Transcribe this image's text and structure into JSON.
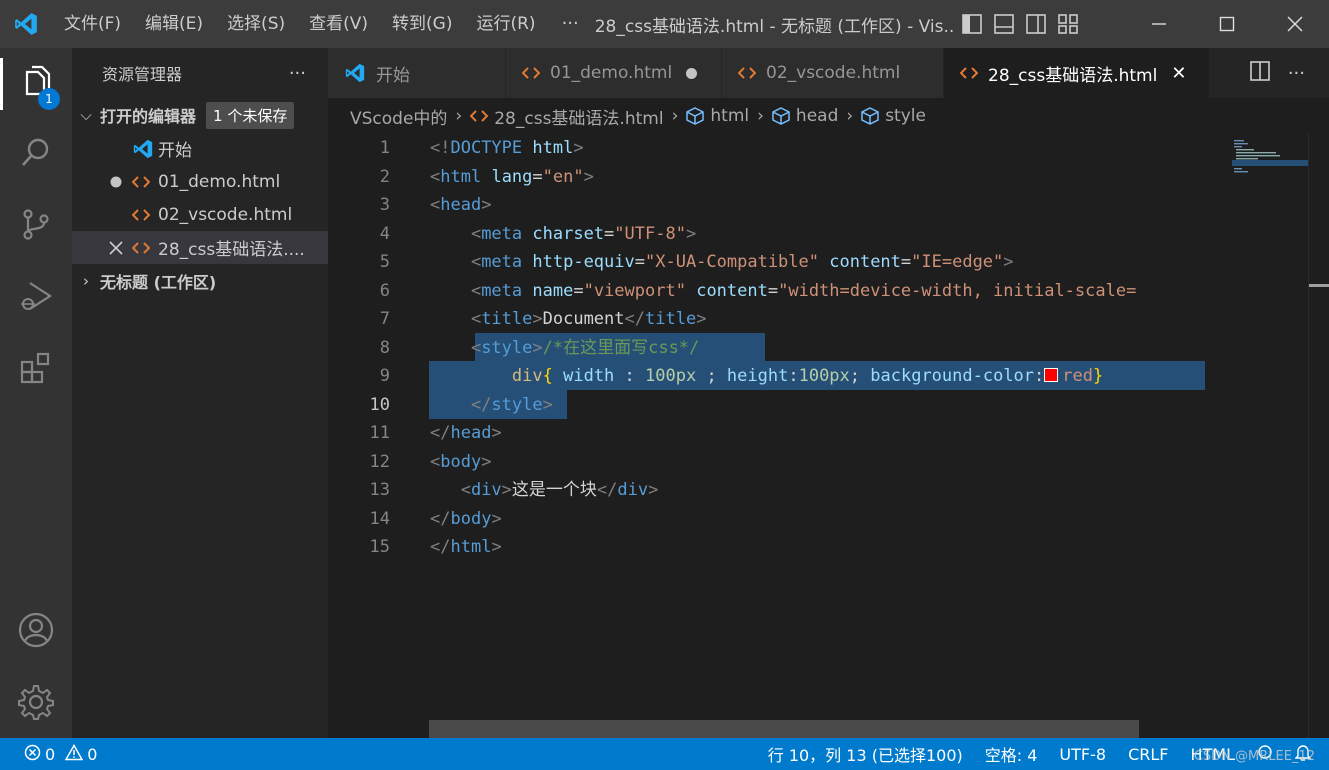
{
  "menu": [
    "文件(F)",
    "编辑(E)",
    "选择(S)",
    "查看(V)",
    "转到(G)",
    "运行(R)"
  ],
  "menu_more": "···",
  "window_title": "28_css基础语法.html - 无标题 (工作区) - Vis...",
  "activity": {
    "explorer_badge": "1"
  },
  "sidebar": {
    "title": "资源管理器",
    "more": "···",
    "open_editors": "打开的编辑器",
    "unsaved": "1 个未保存",
    "files": [
      "开始",
      "01_demo.html",
      "02_vscode.html",
      "28_css基础语法...."
    ],
    "workspace": "无标题 (工作区)"
  },
  "tabs": [
    "开始",
    "01_demo.html",
    "02_vscode.html",
    "28_css基础语法.html"
  ],
  "breadcrumb": [
    "VScode中的",
    "28_css基础语法.html",
    "html",
    "head",
    "style"
  ],
  "line_numbers": [
    "1",
    "2",
    "3",
    "4",
    "5",
    "6",
    "7",
    "8",
    "9",
    "10",
    "11",
    "12",
    "13",
    "14",
    "15"
  ],
  "code": {
    "l1": [
      "<!",
      "DOCTYPE",
      " ",
      "html",
      ">"
    ],
    "l2": [
      "<",
      "html",
      " ",
      "lang",
      "=",
      "\"en\"",
      ">"
    ],
    "l3": [
      "<",
      "head",
      ">"
    ],
    "l4": [
      "    <",
      "meta",
      " ",
      "charset",
      "=",
      "\"UTF-8\"",
      ">"
    ],
    "l5": [
      "    <",
      "meta",
      " ",
      "http-equiv",
      "=",
      "\"X-UA-Compatible\"",
      " ",
      "content",
      "=",
      "\"IE=edge\"",
      ">"
    ],
    "l6": [
      "    <",
      "meta",
      " ",
      "name",
      "=",
      "\"viewport\"",
      " ",
      "content",
      "=",
      "\"width=device-width, initial-scale="
    ],
    "l7": [
      "    <",
      "title",
      ">",
      "Document",
      "</",
      "title",
      ">"
    ],
    "l8": [
      "    <",
      "style",
      ">",
      "/*在这里面写css*/"
    ],
    "l9": [
      "        ",
      "div",
      "{",
      " ",
      "width",
      " : ",
      "100px",
      " ; ",
      "height",
      ":",
      "100px",
      "; ",
      "background-color",
      ":",
      "red",
      "}"
    ],
    "l10": [
      "    </",
      "style",
      ">"
    ],
    "l11": [
      "</",
      "head",
      ">"
    ],
    "l12": [
      "<",
      "body",
      ">"
    ],
    "l13": [
      "   <",
      "div",
      ">",
      "这是一个块",
      "</",
      "div",
      ">"
    ],
    "l14": [
      "</",
      "body",
      ">"
    ],
    "l15": [
      "</",
      "html",
      ">"
    ]
  },
  "status": {
    "errors": "0",
    "warnings": "0",
    "position": "行 10，列 13 (已选择100)",
    "indent": "空格: 4",
    "encoding": "UTF-8",
    "eol": "CRLF",
    "language": "HTML"
  },
  "watermark": "CSDN @MRLEE_12"
}
